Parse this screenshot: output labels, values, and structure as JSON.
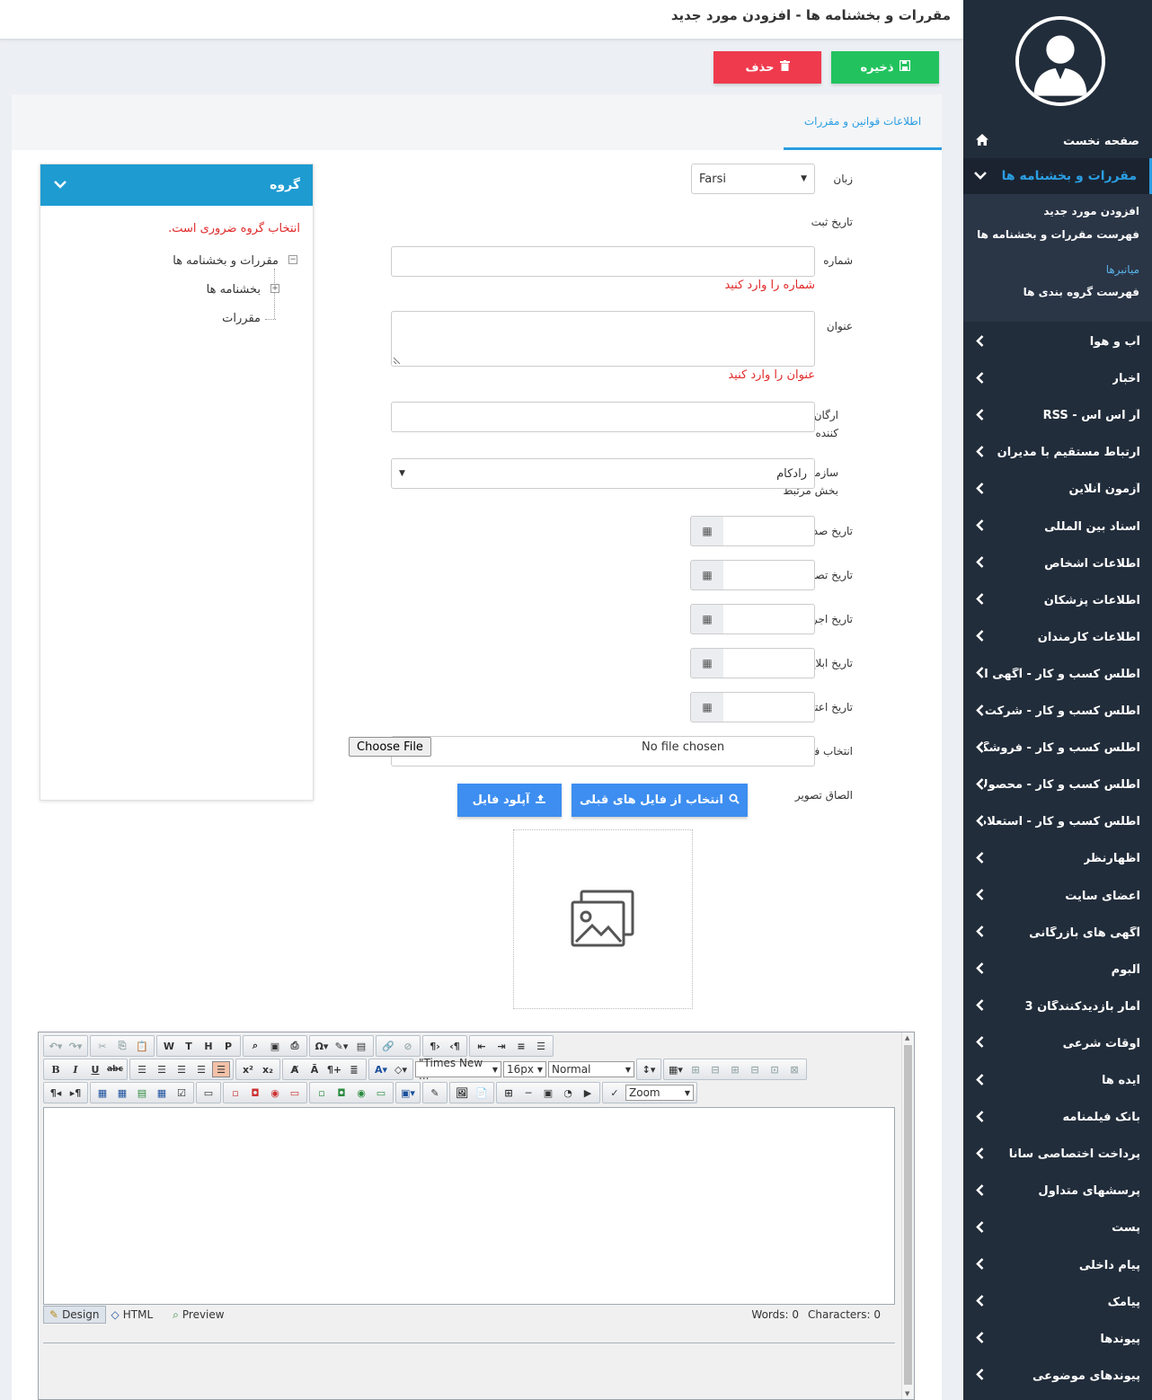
{
  "header": {
    "title": "مقررات و بخشنامه ها - افزودن مورد جدید"
  },
  "actions": {
    "save": "ذخیره",
    "delete": "حذف"
  },
  "tabs": [
    {
      "label": "اطلاعات قوانین و مقررات"
    }
  ],
  "form": {
    "language_label": "زبان",
    "language_value": "Farsi",
    "reg_date_label": "تاریخ ثبت",
    "number_label": "شماره",
    "number_error": "شماره را وارد کنید",
    "title_label": "عنوان",
    "title_error": "عنوان را وارد کنید",
    "issuer_label": "ارگان صادر کننده",
    "org_label": "سازمان یا بخش مرتبط",
    "org_value": "رادکام",
    "issue_date_label": "تاریخ صدور",
    "approve_date_label": "تاریخ تصویب",
    "exec_date_label": "تاریخ اجرا",
    "notify_date_label": "تاریخ ابلاغ",
    "valid_date_label": "تاریخ اعتبار",
    "file_label": "انتخاب فایل",
    "choose_file": "Choose File",
    "no_file": "No file chosen",
    "image_label": "الصاق تصویر",
    "pick_previous": "انتخاب از فایل های قبلی",
    "upload": "آپلود فایل"
  },
  "group": {
    "title": "گروه",
    "error": "انتخاب گروه ضروری است.",
    "tree": {
      "root": "مقررات و بخشنامه ها",
      "children": [
        "بخشنامه ها",
        "مقررات"
      ]
    }
  },
  "editor": {
    "font": "\"Times New ...",
    "size": "16px",
    "format": "Normal",
    "zoom": "Zoom",
    "modes": [
      "Design",
      "HTML",
      "Preview"
    ],
    "words": "Words: 0",
    "chars": "Characters: 0"
  },
  "sidebar": {
    "home": "صفحه نخست",
    "active": "مقررات و بخشنامه ها",
    "sub": [
      "افزودن مورد جدید",
      "فهرست مقررات و بخشنامه ها",
      "میانبرها",
      "فهرست گروه بندی ها"
    ],
    "items": [
      "آب و هوا",
      "اخبار",
      "آر اس اس - RSS",
      "ارتباط مستقیم با مدیران",
      "آزمون آنلاین",
      "اسناد بین المللی",
      "اطلاعات اشخاص",
      "اطلاعات پزشکان",
      "اطلاعات کارمندان",
      "اطلس کسب و کار - آگهی استخدام",
      "اطلس کسب و کار - شرکت ها",
      "اطلس کسب و کار - فروشگاه",
      "اطلس کسب و کار - محصولات",
      "اطلس کسب و کار - استعلام قیمت",
      "اظهارنظر",
      "اعضای سایت",
      "آگهی های بازرگانی",
      "آلبوم",
      "آمار بازدیدکنندگان 3",
      "اوقات شرعی",
      "ایده ها",
      "بانک فیلمنامه",
      "پرداخت اختصاصی سانا",
      "پرسشهای متداول",
      "پست",
      "پیام داخلی",
      "پیامک",
      "پیوندها",
      "پیوندهای موضوعی"
    ]
  },
  "colors": {
    "sidebar": "#222d3b",
    "accent": "#2b9ee2",
    "save": "#22c35e",
    "delete": "#ef3a4d",
    "primary": "#3d8ef0",
    "group_header": "#1e9bd1",
    "error": "#e02a2a"
  }
}
